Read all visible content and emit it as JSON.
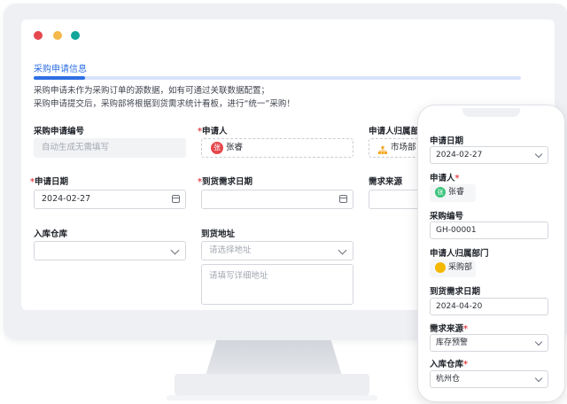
{
  "section": {
    "title": "采购申请信息",
    "desc_line1": "采购申请未作为采购订单的源数据，如有可通过关联数据配置；",
    "desc_line2": "采购申请提交后，采购部将根据到货需求统计看板，进行“统一”采购！"
  },
  "form": {
    "request_no": {
      "label": "采购申请编号",
      "placeholder": "自动生成无需填写"
    },
    "applicant": {
      "label": "申请人",
      "required": "*",
      "value": "张睿",
      "avatar": "张"
    },
    "dept": {
      "label": "申请人归属部门",
      "value": "市场部"
    },
    "apply_date": {
      "label": "申请日期",
      "required": "*",
      "value": "2024-02-27"
    },
    "arrival_date": {
      "label": "到货需求日期",
      "required": "*",
      "value": ""
    },
    "demand_source": {
      "label": "需求来源"
    },
    "warehouse": {
      "label": "入库仓库",
      "value": ""
    },
    "address": {
      "label": "到货地址",
      "select_placeholder": "请选择地址",
      "detail_placeholder": "请填写详细地址"
    }
  },
  "mobile": {
    "apply_date": {
      "label": "申请日期",
      "value": "2024-02-27"
    },
    "applicant": {
      "label": "申请人",
      "required": "*",
      "value": "张睿",
      "avatar": "张"
    },
    "purchase_no": {
      "label": "采购编号",
      "value": "GH-00001"
    },
    "dept": {
      "label": "申请人归属部门",
      "value": "采购部"
    },
    "arrival_date": {
      "label": "到货需求日期",
      "value": "2024-04-20"
    },
    "demand_source": {
      "label": "需求来源",
      "required": "*",
      "value": "库存预警"
    },
    "warehouse": {
      "label": "入库仓库",
      "required": "*",
      "value": "杭州仓"
    }
  },
  "colors": {
    "accent": "#2f6fe4",
    "required": "#e5484d"
  }
}
